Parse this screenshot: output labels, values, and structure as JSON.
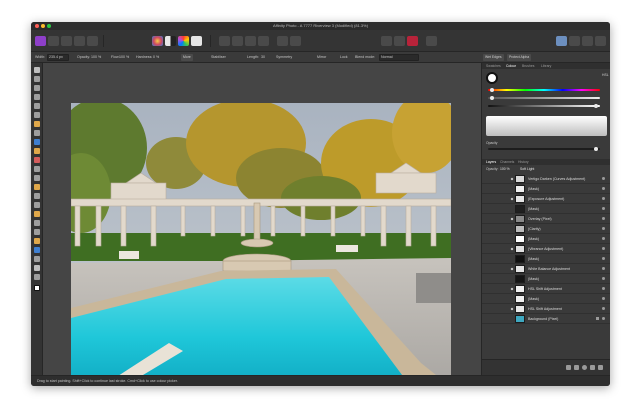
{
  "window": {
    "title": "Affinity Photo - A 7777 Riverview 3 (Modified) (81.3%)",
    "traffic_colors": [
      "#fe5f57",
      "#febc2e",
      "#28c840"
    ]
  },
  "context_bar": {
    "width_label": "Width:",
    "width_value": "235.4 px",
    "opacity_label": "Opacity:",
    "opacity_value": "100 %",
    "flow_label": "Flow:",
    "flow_value": "100 %",
    "hardness_label": "Hardness:",
    "hardness_value": "0 %",
    "more_label": "More",
    "stabiliser_label": "Stabiliser",
    "length_label": "Length:",
    "length_value": "30",
    "symmetry_label": "Symmetry",
    "mirror_label": "Mirror",
    "lock_label": "Lock",
    "blend_mode_label": "Blend mode:",
    "blend_mode_value": "Normal",
    "wet_edges_label": "Wet Edges",
    "protect_alpha_label": "Protect Alpha"
  },
  "colour_panel": {
    "tabs": [
      "Swatches",
      "Colour",
      "Brushes",
      "Library"
    ],
    "mode": "HSL",
    "opacity_label": "Opacity",
    "accent": "#a8a8a8"
  },
  "layers_panel": {
    "tabs": [
      "Layers",
      "Channels",
      "History"
    ],
    "opacity_label": "Opacity:",
    "opacity_value": "100 %",
    "blend_value": "Soft Light",
    "layers": [
      {
        "name": "Vertigo Darken (Curves Adjustment)",
        "thumb": "#d8d8d8"
      },
      {
        "name": "(Mask)",
        "thumb": "#f0f0f0"
      },
      {
        "name": "(Exposure Adjustment)",
        "thumb": "#e6e6e6"
      },
      {
        "name": "(Mask)",
        "thumb": "#1f1f1f"
      },
      {
        "name": "Overlay (Pixel)",
        "thumb": "#8a8a8a"
      },
      {
        "name": "(Clarity)",
        "thumb": "#bdbdbd"
      },
      {
        "name": "(Mask)",
        "thumb": "#ffffff"
      },
      {
        "name": "(Vibrance Adjustment)",
        "thumb": "#e0e0e0"
      },
      {
        "name": "(Mask)",
        "thumb": "#101010"
      },
      {
        "name": "White Balance Adjustment",
        "thumb": "#e4e4e4"
      },
      {
        "name": "(Mask)",
        "thumb": "#151515"
      },
      {
        "name": "HSL Shift Adjustment",
        "thumb": "#f0f0f0"
      },
      {
        "name": "(Mask)",
        "thumb": "#f0f0f0"
      },
      {
        "name": "HSL Shift Adjustment",
        "thumb": "#e8e8e8"
      },
      {
        "name": "Background (Pixel)",
        "thumb": "#3fa8c0"
      }
    ]
  },
  "status": {
    "text": "Drag to start painting. Shift+Click to continue last stroke. Cmd+Click to use colour picker."
  }
}
